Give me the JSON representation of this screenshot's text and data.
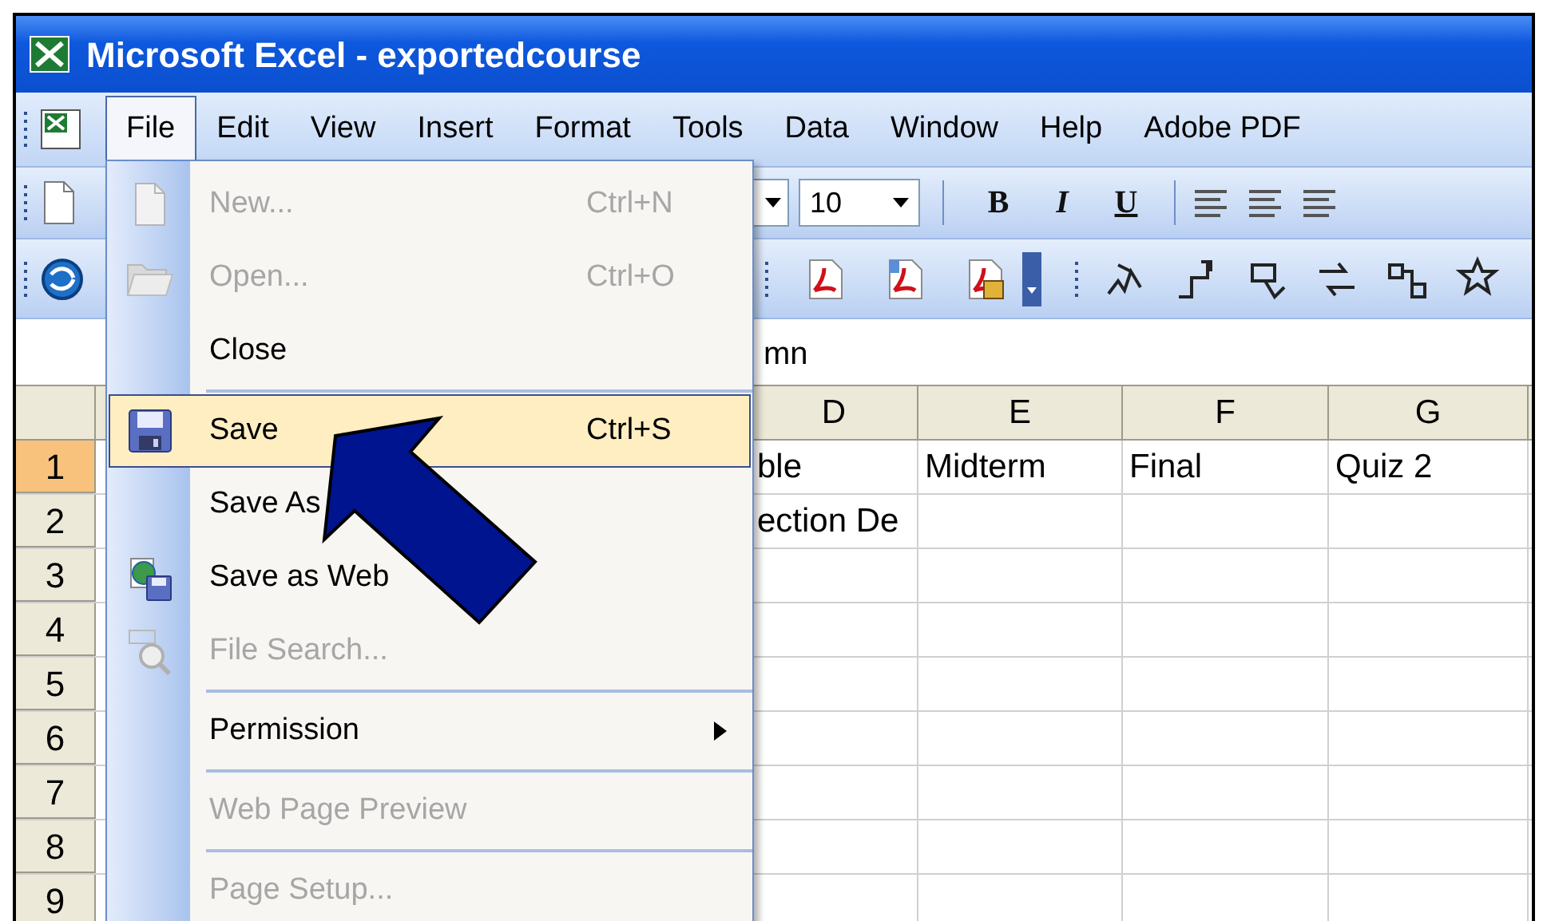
{
  "window": {
    "title": "Microsoft Excel - exportedcourse"
  },
  "menu_bar": [
    {
      "label": "File",
      "selected": true
    },
    {
      "label": "Edit",
      "selected": false
    },
    {
      "label": "View",
      "selected": false
    },
    {
      "label": "Insert",
      "selected": false
    },
    {
      "label": "Format",
      "selected": false
    },
    {
      "label": "Tools",
      "selected": false
    },
    {
      "label": "Data",
      "selected": false
    },
    {
      "label": "Window",
      "selected": false
    },
    {
      "label": "Help",
      "selected": false
    },
    {
      "label": "Adobe PDF",
      "selected": false
    }
  ],
  "formatting_toolbar": {
    "font_size": "10",
    "buttons": [
      "B",
      "I",
      "U"
    ]
  },
  "formula_bar": {
    "value": "mn"
  },
  "sheet": {
    "columns": [
      {
        "label": "D"
      },
      {
        "label": "E"
      },
      {
        "label": "F"
      },
      {
        "label": "G"
      }
    ],
    "rows": [
      {
        "label": "1",
        "selected": true,
        "cells": [
          "ble",
          "Midterm",
          "Final",
          "Quiz 2"
        ]
      },
      {
        "label": "2",
        "selected": false,
        "cells": [
          "ection De"
        ]
      },
      {
        "label": "3",
        "selected": false
      },
      {
        "label": "4",
        "selected": false
      },
      {
        "label": "5",
        "selected": false
      },
      {
        "label": "6",
        "selected": false
      },
      {
        "label": "7",
        "selected": false
      },
      {
        "label": "8",
        "selected": false
      },
      {
        "label": "9",
        "selected": false
      }
    ]
  },
  "file_menu": {
    "items": [
      {
        "kind": "item",
        "label": "New...",
        "shortcut": "Ctrl+N",
        "disabled": true,
        "selected": false,
        "submenu": false
      },
      {
        "kind": "item",
        "label": "Open...",
        "shortcut": "Ctrl+O",
        "disabled": true,
        "selected": false,
        "submenu": false
      },
      {
        "kind": "item",
        "label": "Close",
        "disabled": false,
        "selected": false,
        "submenu": false
      },
      {
        "kind": "separator"
      },
      {
        "kind": "item",
        "label": "Save",
        "shortcut": "Ctrl+S",
        "disabled": false,
        "selected": true,
        "submenu": false
      },
      {
        "kind": "item",
        "label": "Save As",
        "disabled": false,
        "selected": false,
        "submenu": false
      },
      {
        "kind": "item",
        "label": "Save as Web",
        "disabled": false,
        "selected": false,
        "submenu": false
      },
      {
        "kind": "item",
        "label": "File Search...",
        "disabled": true,
        "selected": false,
        "submenu": false
      },
      {
        "kind": "separator"
      },
      {
        "kind": "item",
        "label": "Permission",
        "disabled": false,
        "selected": false,
        "submenu": true
      },
      {
        "kind": "separator"
      },
      {
        "kind": "item",
        "label": "Web Page Preview",
        "disabled": true,
        "selected": false,
        "submenu": false
      },
      {
        "kind": "separator"
      },
      {
        "kind": "item",
        "label": "Page Setup...",
        "disabled": true,
        "selected": false,
        "submenu": false
      }
    ]
  }
}
